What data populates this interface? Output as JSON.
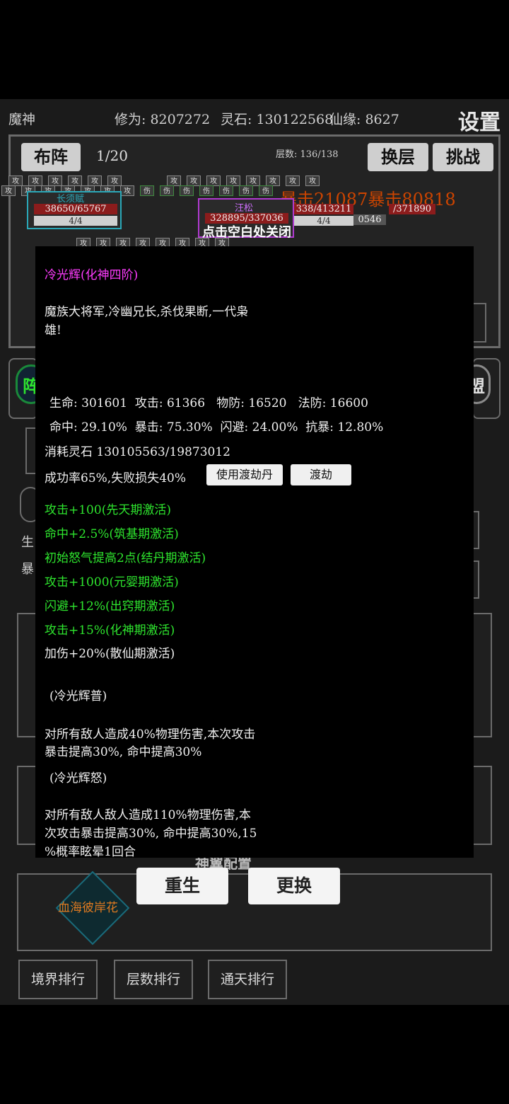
{
  "header": {
    "realm": "魔神",
    "cultivation": "修为: 8207272",
    "spirit_stones": "灵石: 130122568",
    "fate": "仙缘: 8627",
    "settings": "设置"
  },
  "battle": {
    "formation_btn": "布阵",
    "progress": "1/20",
    "floor": "层数: 136/138",
    "switch_floor": "换层",
    "challenge": "挑战",
    "chip_text": "攻",
    "chip_injured": "伤",
    "floating_text": "暴击21087暴击80818",
    "close_hint": "点击空白处关闭"
  },
  "units": [
    {
      "name": "长须赋",
      "hp": "38650/65767",
      "count": "4/4"
    },
    {
      "name": "汪松",
      "hp": "328895/337036",
      "count": "4/4"
    },
    {
      "hp": "338/413211",
      "count": "4/4"
    },
    {
      "hp": "0546",
      "count": "4/4"
    },
    {
      "hp": "/371890",
      "count": ""
    }
  ],
  "side": {
    "left_char": "阵",
    "right_char": "盟",
    "left_labels": [
      "生",
      "暴"
    ]
  },
  "popup": {
    "title": "冷光辉(化神四阶)",
    "desc_line1": "魔族大将军,冷幽兄长,杀伐果断,一代枭",
    "desc_line2": "雄!",
    "stats1": "生命: 301601  攻击: 61366   物防: 16520   法防: 16600",
    "stats2": "命中: 29.10%  暴击: 75.30%  闪避: 24.00%  抗暴: 12.80%",
    "cost": "消耗灵石 130105563/19873012",
    "success": "成功率65%,失败损失40%",
    "use_pill": "使用渡劫丹",
    "tribulation": "渡劫",
    "bonuses_active": [
      "攻击+100(先天期激活)",
      "命中+2.5%(筑基期激活)",
      "初始怒气提高2点(结丹期激活)",
      "攻击+1000(元婴期激活)",
      "闪避+12%(出窍期激活)",
      "攻击+15%(化神期激活)"
    ],
    "bonus_inactive": "加伤+20%(散仙期激活)",
    "skill1_name": "(冷光辉普)",
    "skill1_line1": "对所有敌人造成40%物理伤害,本次攻击",
    "skill1_line2": "暴击提高30%, 命中提高30%",
    "skill2_name": "(冷光辉怒)",
    "skill2_line1": "对所有敌人敌人造成110%物理伤害,本",
    "skill2_line2": "次攻击暴击提高30%, 命中提高30%,15",
    "skill2_line3": "%概率眩晕1回合"
  },
  "bottom": {
    "divine_title": "神翼配置",
    "item_name": "血海彼岸花",
    "rebirth": "重生",
    "replace": "更换",
    "rank_realm": "境界排行",
    "rank_floor": "层数排行",
    "rank_tongtian": "通天排行"
  },
  "colors": {
    "green": "#2ee52e",
    "magenta": "#ff3cff",
    "hp_bar": "#8c1c1c"
  }
}
